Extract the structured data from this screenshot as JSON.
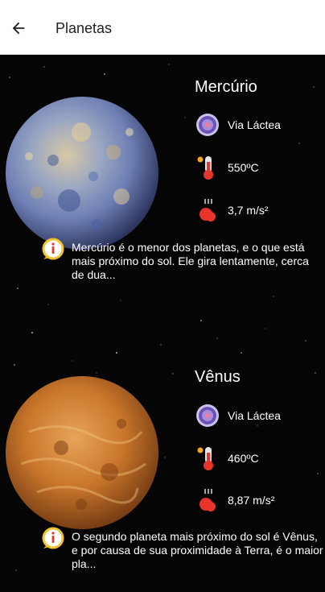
{
  "header": {
    "title": "Planetas",
    "back_icon": "arrow-left-icon"
  },
  "planets": [
    {
      "name": "Mercúrio",
      "galaxy": "Via Láctea",
      "temperature": "550ºC",
      "gravity": "3,7 m/s²",
      "description": "Mercúrio é o menor dos planetas, e o que está mais próximo do sol. Ele gira lentamente, cerca de dua..."
    },
    {
      "name": "Vênus",
      "galaxy": "Via Láctea",
      "temperature": "460ºC",
      "gravity": "8,87 m/s²",
      "description": "O segundo planeta mais próximo do sol é Vênus, e por causa de sua proximidade à Terra, é o maior pla..."
    }
  ],
  "colors": {
    "background": "#000000",
    "text": "#ffffff",
    "info_border": "#f2c230",
    "info_icon": "#e8352a"
  }
}
